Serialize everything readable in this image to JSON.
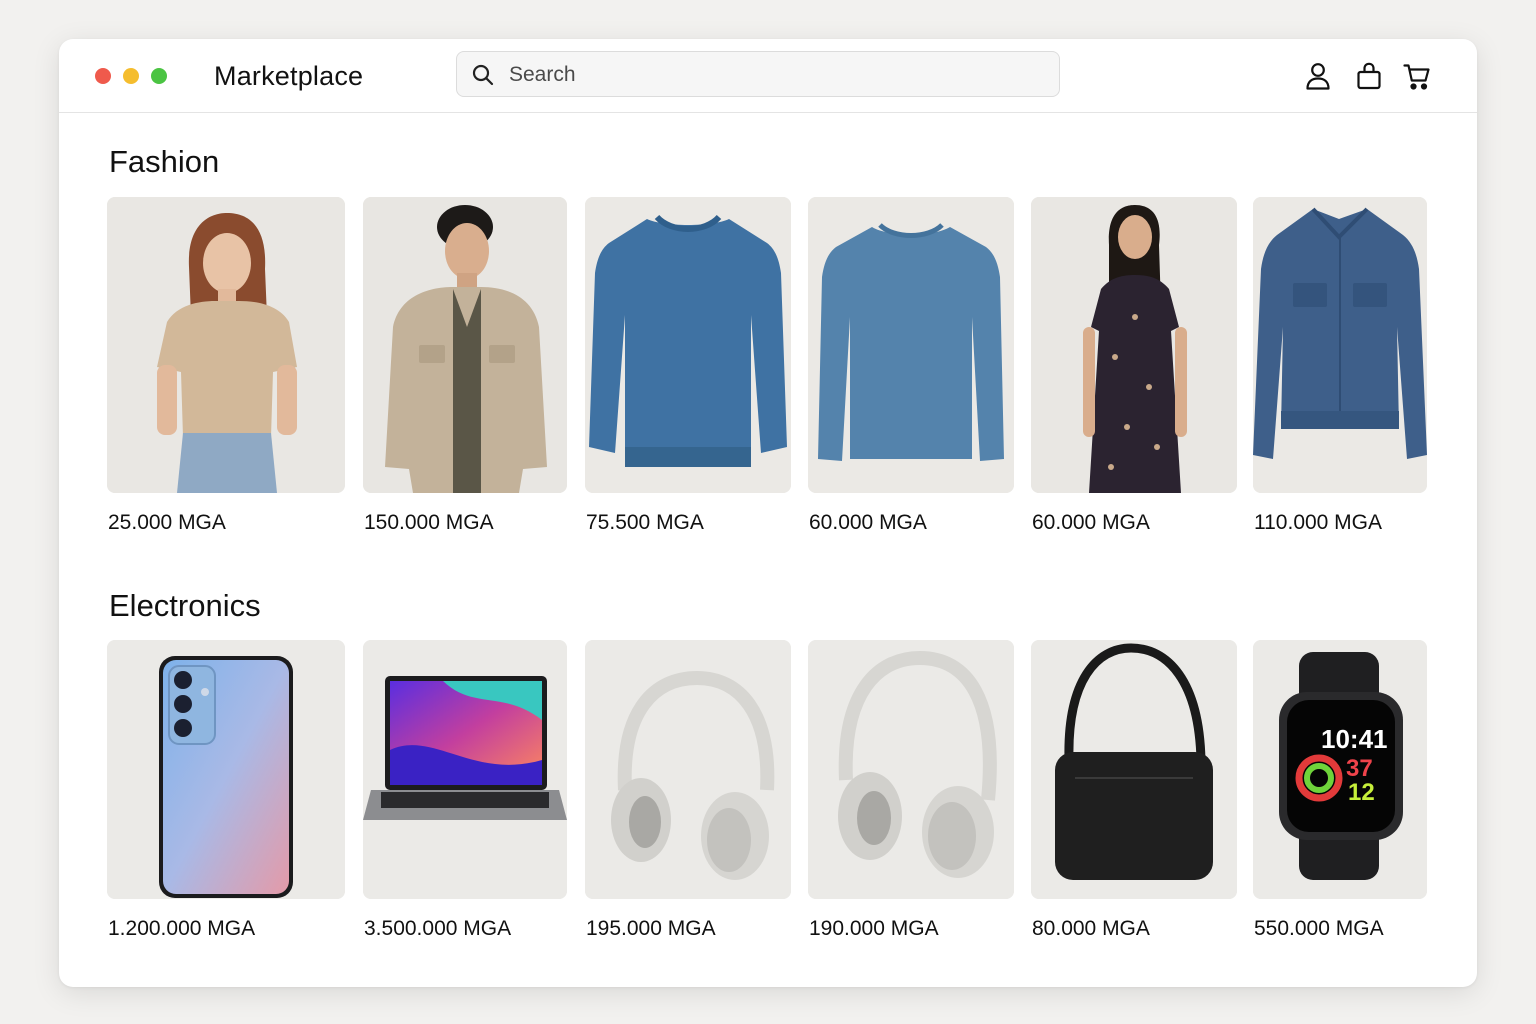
{
  "window": {
    "controls": {
      "close_color": "#ef5a4c",
      "minimize_color": "#f5bd2e",
      "zoom_color": "#4bc443"
    },
    "title": "Marketplace"
  },
  "search": {
    "placeholder": "Search",
    "value": "",
    "icon": "search-icon"
  },
  "header_icons": [
    {
      "name": "account-icon"
    },
    {
      "name": "shopping-bag-icon"
    },
    {
      "name": "cart-icon"
    }
  ],
  "sections": [
    {
      "title": "Fashion",
      "products": [
        {
          "name": "beige-tshirt",
          "price": "25.000 MGA"
        },
        {
          "name": "beige-jacket",
          "price": "150.000 MGA"
        },
        {
          "name": "blue-knit-sweater",
          "price": "75.500 MGA"
        },
        {
          "name": "blue-sweater",
          "price": "60.000 MGA"
        },
        {
          "name": "floral-dress",
          "price": "60.000 MGA"
        },
        {
          "name": "denim-jacket",
          "price": "110.000 MGA"
        }
      ]
    },
    {
      "title": "Electronics",
      "products": [
        {
          "name": "smartphone",
          "price": "1.200.000 MGA"
        },
        {
          "name": "laptop",
          "price": "3.500.000 MGA"
        },
        {
          "name": "headphones-1",
          "price": "195.000 MGA"
        },
        {
          "name": "headphones-2",
          "price": "190.000 MGA"
        },
        {
          "name": "black-bag",
          "price": "80.000 MGA"
        },
        {
          "name": "smartwatch",
          "price": "550.000 MGA",
          "watch_time": "10:41",
          "watch_numbers": [
            "37",
            "12"
          ]
        }
      ]
    }
  ]
}
